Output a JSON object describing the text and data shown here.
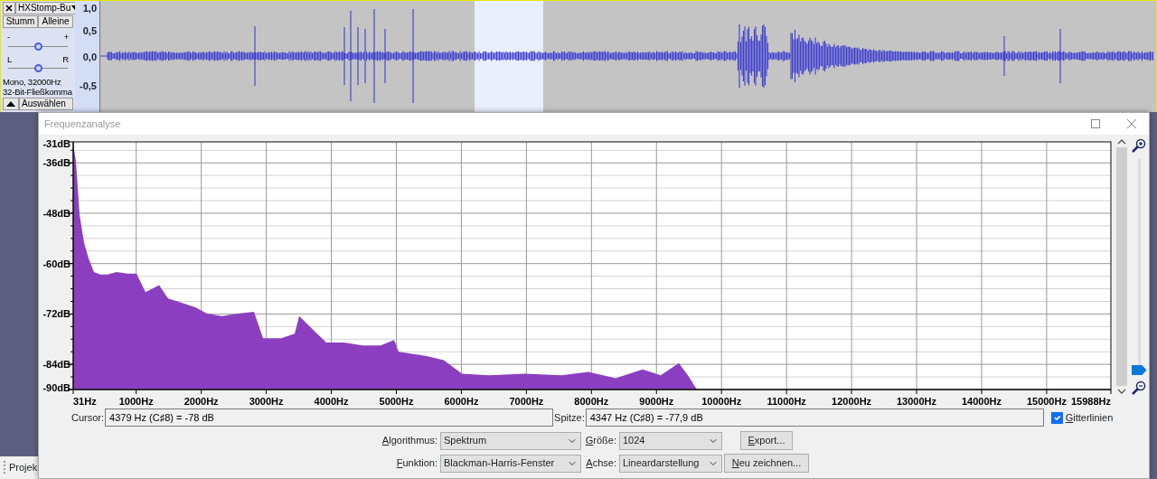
{
  "track": {
    "name": "HXStomp-Bu",
    "buttons": [
      "Stumm",
      "Alleine"
    ],
    "gain": {
      "min_label": "-",
      "max_label": "+",
      "level": 0.5
    },
    "pan": {
      "left_label": "L",
      "right_label": "R",
      "level": 0.5
    },
    "info": [
      "Mono, 32000Hz",
      "32-Bit-Fließkomma"
    ],
    "select_button": "Auswählen",
    "ruler": [
      "1,0",
      "0,5",
      "0,0",
      "-0,5"
    ]
  },
  "background": {
    "tab": "Projek"
  },
  "dialog": {
    "title": "Frequenzanalyse",
    "chart_data": {
      "type": "area",
      "grid": true,
      "x": [
        31,
        31,
        73,
        128,
        198,
        267,
        351,
        448,
        559,
        698,
        865,
        1004,
        1143,
        1351,
        1490,
        1699,
        1908,
        2088,
        2325,
        2561,
        2811,
        2950,
        3228,
        3437,
        3506,
        3715,
        3923,
        4201,
        4479,
        4757,
        4966,
        5035,
        5452,
        5730,
        6008,
        6425,
        6981,
        7537,
        7954,
        8371,
        8788,
        9066,
        9344,
        9483,
        9622
      ],
      "series": [
        {
          "color": "#8b3fc0",
          "values": [
            -90,
            -31.4,
            -35.6,
            -48.3,
            -55,
            -58.8,
            -62,
            -62.6,
            -62.6,
            -62,
            -62.4,
            -62.4,
            -66.8,
            -65.1,
            -68.3,
            -69.3,
            -70.4,
            -71.9,
            -72.5,
            -71.9,
            -71.5,
            -77.8,
            -77.8,
            -76.7,
            -72.5,
            -75.7,
            -78.8,
            -78.8,
            -79.5,
            -79.5,
            -78.2,
            -81,
            -82,
            -83,
            -86.2,
            -86.6,
            -86.2,
            -86.6,
            -85.8,
            -87.3,
            -85.2,
            -86.6,
            -83.7,
            -86.6,
            -90
          ]
        }
      ],
      "xlim": [
        31,
        15988
      ],
      "ylim": [
        -90,
        -31
      ],
      "xticks": [
        {
          "value": 31,
          "label": "31Hz"
        },
        {
          "value": 1000,
          "label": "1000Hz"
        },
        {
          "value": 2000,
          "label": "2000Hz"
        },
        {
          "value": 3000,
          "label": "3000Hz"
        },
        {
          "value": 4000,
          "label": "4000Hz"
        },
        {
          "value": 5000,
          "label": "5000Hz"
        },
        {
          "value": 6000,
          "label": "6000Hz"
        },
        {
          "value": 7000,
          "label": "7000Hz"
        },
        {
          "value": 8000,
          "label": "8000Hz"
        },
        {
          "value": 9000,
          "label": "9000Hz"
        },
        {
          "value": 10000,
          "label": "10000Hz"
        },
        {
          "value": 11000,
          "label": "11000Hz"
        },
        {
          "value": 12000,
          "label": "12000Hz"
        },
        {
          "value": 13000,
          "label": "13000Hz"
        },
        {
          "value": 14000,
          "label": "14000Hz"
        },
        {
          "value": 15000,
          "label": "15000Hz"
        },
        {
          "value": 15988,
          "label": "15988Hz"
        }
      ],
      "yticks": [
        {
          "value": -31,
          "label": "-31dB"
        },
        {
          "value": -36,
          "label": "-36dB"
        },
        {
          "value": -48,
          "label": "-48dB"
        },
        {
          "value": -60,
          "label": "-60dB"
        },
        {
          "value": -72,
          "label": "-72dB"
        },
        {
          "value": -84,
          "label": "-84dB"
        },
        {
          "value": -90,
          "label": "-90dB"
        }
      ]
    },
    "zoom_slider": {
      "level": 0
    },
    "cursor": {
      "label": "Cursor:",
      "value": "4379 Hz (C♯8) = -78 dB"
    },
    "peak": {
      "label": "Spitze:",
      "value": "4347 Hz (C♯8) = -77,9 dB"
    },
    "gridlines": {
      "label": "Gitterlinien",
      "checked": true
    },
    "settings": [
      {
        "label": "Algorithmus:",
        "value": "Spektrum"
      },
      {
        "label": "Größe:",
        "value": "1024"
      },
      {
        "label": "Funktion:",
        "value": "Blackman-Harris-Fenster"
      },
      {
        "label": "Achse:",
        "value": "Lineardarstellung"
      }
    ],
    "buttons": [
      "Export...",
      "Neu zeichnen..."
    ]
  }
}
